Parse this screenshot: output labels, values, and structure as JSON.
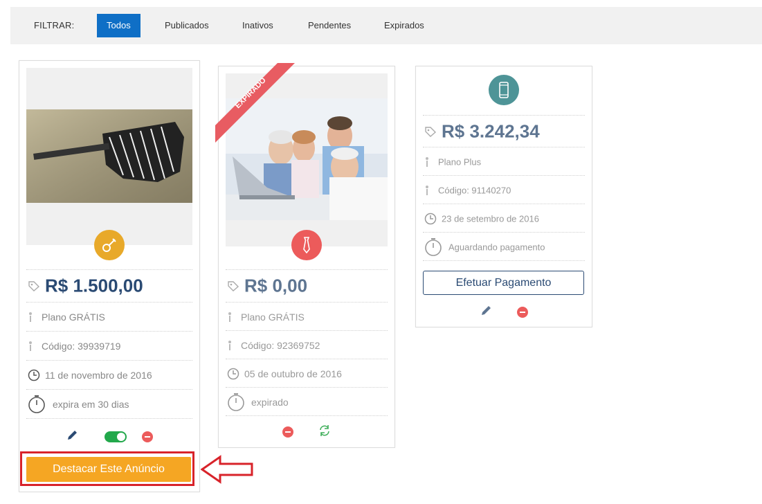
{
  "filter": {
    "label": "FILTRAR:",
    "options": [
      "Todos",
      "Publicados",
      "Inativos",
      "Pendentes",
      "Expirados"
    ]
  },
  "cards": [
    {
      "category_icon": "guitar-icon",
      "category_color": "#e8a92a",
      "price": "R$ 1.500,00",
      "plan": "Plano GRÁTIS",
      "code": "Código: 39939719",
      "date": "11 de novembro de 2016",
      "status": "expira em 30 dias",
      "cta": "Destacar Este Anúncio"
    },
    {
      "ribbon": "EXPIRADO",
      "category_icon": "tie-icon",
      "category_color": "#ec5b5b",
      "price": "R$ 0,00",
      "plan": "Plano GRÁTIS",
      "code": "Código: 92369752",
      "date": "05 de outubro de 2016",
      "status": "expirado"
    },
    {
      "category_icon": "smartphone-icon",
      "category_color": "#4e9497",
      "price": "R$ 3.242,34",
      "plan": "Plano Plus",
      "code": "Código: 91140270",
      "date": "23 de setembro de 2016",
      "status": "Aguardando pagamento",
      "pay_button": "Efetuar Pagamento"
    }
  ],
  "colors": {
    "accent_blue": "#0f6fc6",
    "price_blue": "#2a4a73",
    "cta_orange": "#f5a623",
    "highlight_red": "#d8232a"
  }
}
